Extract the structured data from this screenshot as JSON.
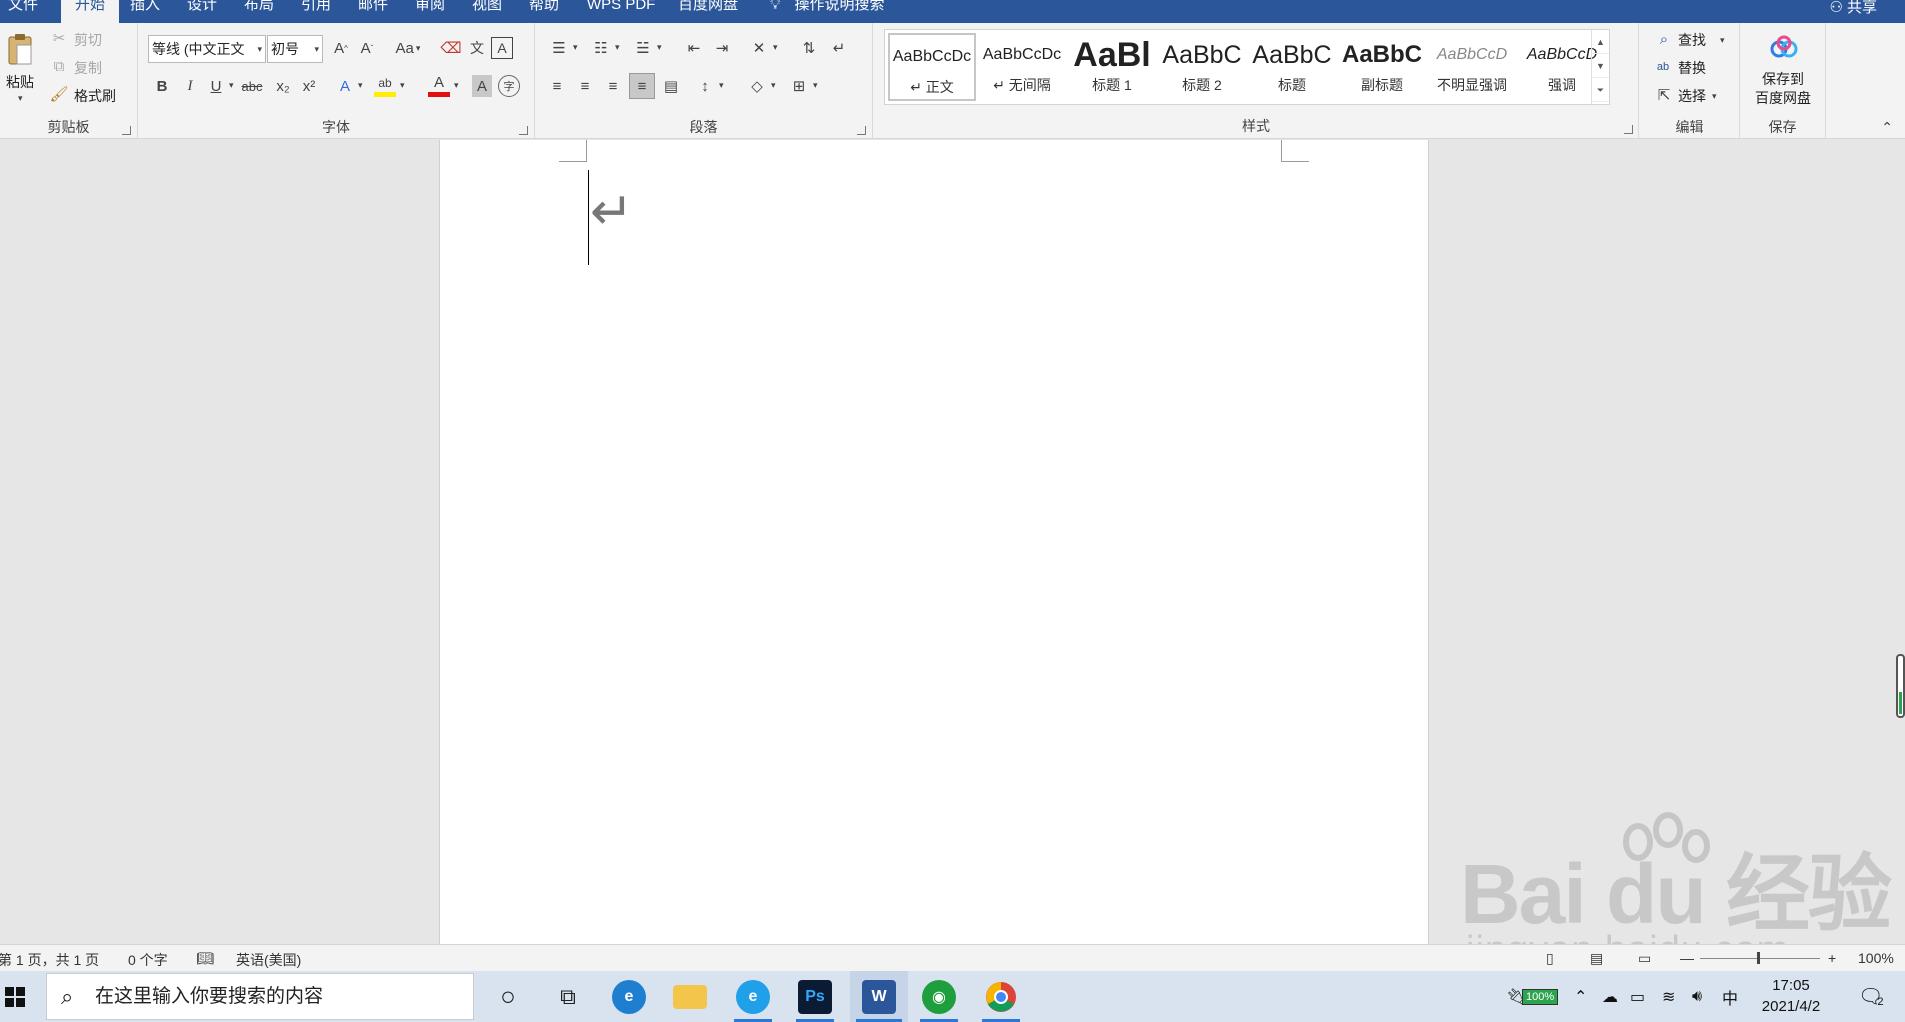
{
  "menu": {
    "tabs": [
      "文件",
      "开始",
      "插入",
      "设计",
      "布局",
      "引用",
      "邮件",
      "审阅",
      "视图",
      "帮助",
      "WPS PDF",
      "百度网盘"
    ],
    "active_tab": "开始",
    "tell_me": "操作说明搜索",
    "share": "共享"
  },
  "clipboard": {
    "paste": "粘贴",
    "cut": "剪切",
    "copy": "复制",
    "format_painter": "格式刷",
    "label": "剪贴板"
  },
  "font": {
    "name": "等线 (中文正文",
    "size": "初号",
    "label": "字体",
    "bold": "B",
    "italic": "I",
    "underline": "U",
    "strike": "abc",
    "subscript": "x₂",
    "superscript": "x²",
    "grow": "A^",
    "shrink": "A˅",
    "change_case": "Aa",
    "pinyin": "文",
    "border_char": "A",
    "text_effects": "A",
    "highlight": "ab",
    "font_color": "A",
    "shading": "A",
    "enclose": "字"
  },
  "paragraph": {
    "label": "段落"
  },
  "styles": {
    "label": "样式",
    "items": [
      {
        "sample": "AaBbCcDc",
        "name": "↵ 正文"
      },
      {
        "sample": "AaBbCcDc",
        "name": "↵ 无间隔"
      },
      {
        "sample": "AaBl",
        "name": "标题 1"
      },
      {
        "sample": "AaBbC",
        "name": "标题 2"
      },
      {
        "sample": "AaBbC",
        "name": "标题"
      },
      {
        "sample": "AaBbC",
        "name": "副标题"
      },
      {
        "sample": "AaBbCcD",
        "name": "不明显强调"
      },
      {
        "sample": "AaBbCcD",
        "name": "强调"
      }
    ]
  },
  "editing": {
    "find": "查找",
    "replace": "替换",
    "select": "选择",
    "label": "编辑"
  },
  "save": {
    "button": "保存到\n百度网盘",
    "line1": "保存到",
    "line2": "百度网盘",
    "label": "保存"
  },
  "status": {
    "page": "第 1 页，共 1 页",
    "words": "0 个字",
    "language": "英语(美国)",
    "zoom": "100%"
  },
  "watermark": {
    "main": "Bai du 经验",
    "sub": "jingyan.baidu.com"
  },
  "taskbar": {
    "search_placeholder": "在这里输入你要搜索的内容",
    "apps": [
      {
        "name": "cortana",
        "glyph": "○"
      },
      {
        "name": "task-view",
        "glyph": "⧉"
      },
      {
        "name": "edge",
        "glyph": "e"
      },
      {
        "name": "file-explorer",
        "glyph": "▬"
      },
      {
        "name": "ie",
        "glyph": "e"
      },
      {
        "name": "photoshop",
        "glyph": "Ps"
      },
      {
        "name": "word",
        "glyph": "W"
      },
      {
        "name": "evernote",
        "glyph": "◉"
      },
      {
        "name": "chrome",
        "glyph": "◎"
      }
    ],
    "battery": "100%",
    "ime": "中",
    "time": "17:05",
    "date": "2021/4/2",
    "notification_count": "2"
  },
  "colors": {
    "accent": "#2b579a",
    "ribbon_bg": "#f3f3f3",
    "highlight_yellow": "#ffee00",
    "font_red": "#e01010"
  }
}
